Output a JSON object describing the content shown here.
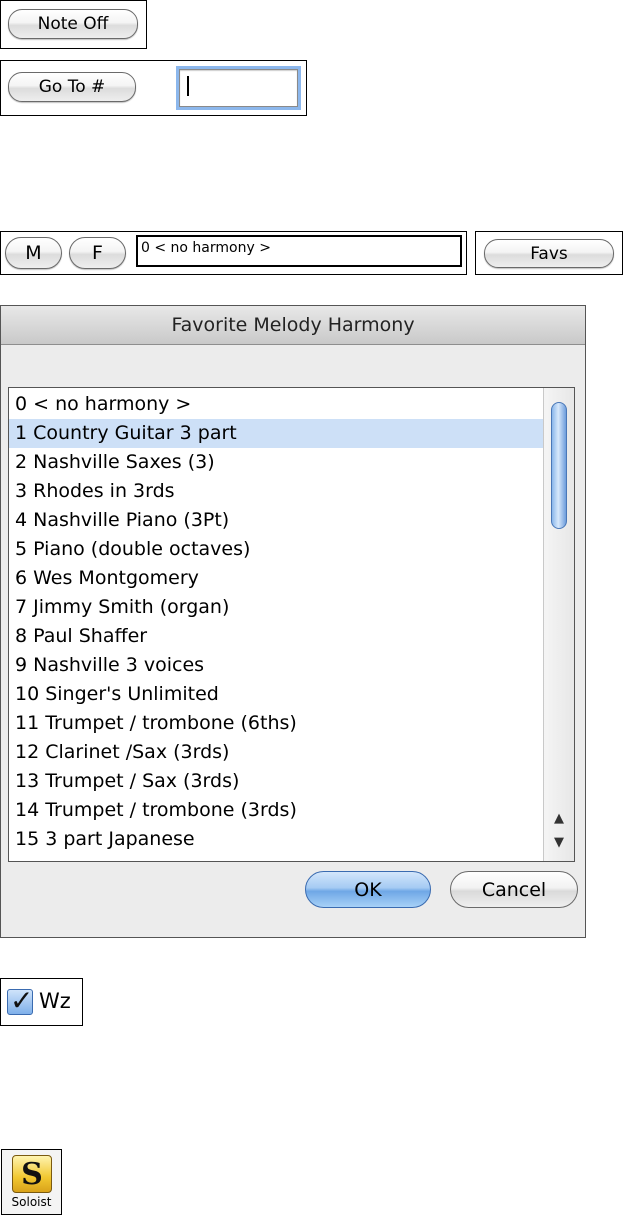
{
  "note_off": {
    "label": "Note Off"
  },
  "go_to": {
    "label": "Go To #",
    "value": ""
  },
  "harmony_bar": {
    "m_label": "M",
    "f_label": "F",
    "current_value": "0 < no harmony >",
    "favs_label": "Favs"
  },
  "dialog": {
    "title": "Favorite Melody Harmony",
    "items": [
      "0 < no harmony >",
      "1 Country Guitar 3 part",
      "2 Nashville Saxes (3)",
      "3 Rhodes in 3rds",
      "4 Nashville Piano (3Pt)",
      "5 Piano (double octaves)",
      "6 Wes Montgomery",
      "7 Jimmy Smith (organ)",
      "8 Paul Shaffer",
      "9 Nashville 3 voices",
      "10 Singer's Unlimited",
      "11 Trumpet / trombone (6ths)",
      "12 Clarinet /Sax (3rds)",
      "13 Trumpet / Sax (3rds)",
      "14 Trumpet / trombone (3rds)",
      "15 3 part Japanese"
    ],
    "selected_index": 1,
    "ok_label": "OK",
    "cancel_label": "Cancel",
    "scroll_up_glyph": "▲",
    "scroll_down_glyph": "▼"
  },
  "wz_checkbox": {
    "label": "Wz",
    "checked": true,
    "check_glyph": "✓"
  },
  "soloist_button": {
    "logo_letter": "S",
    "label": "Soloist"
  }
}
